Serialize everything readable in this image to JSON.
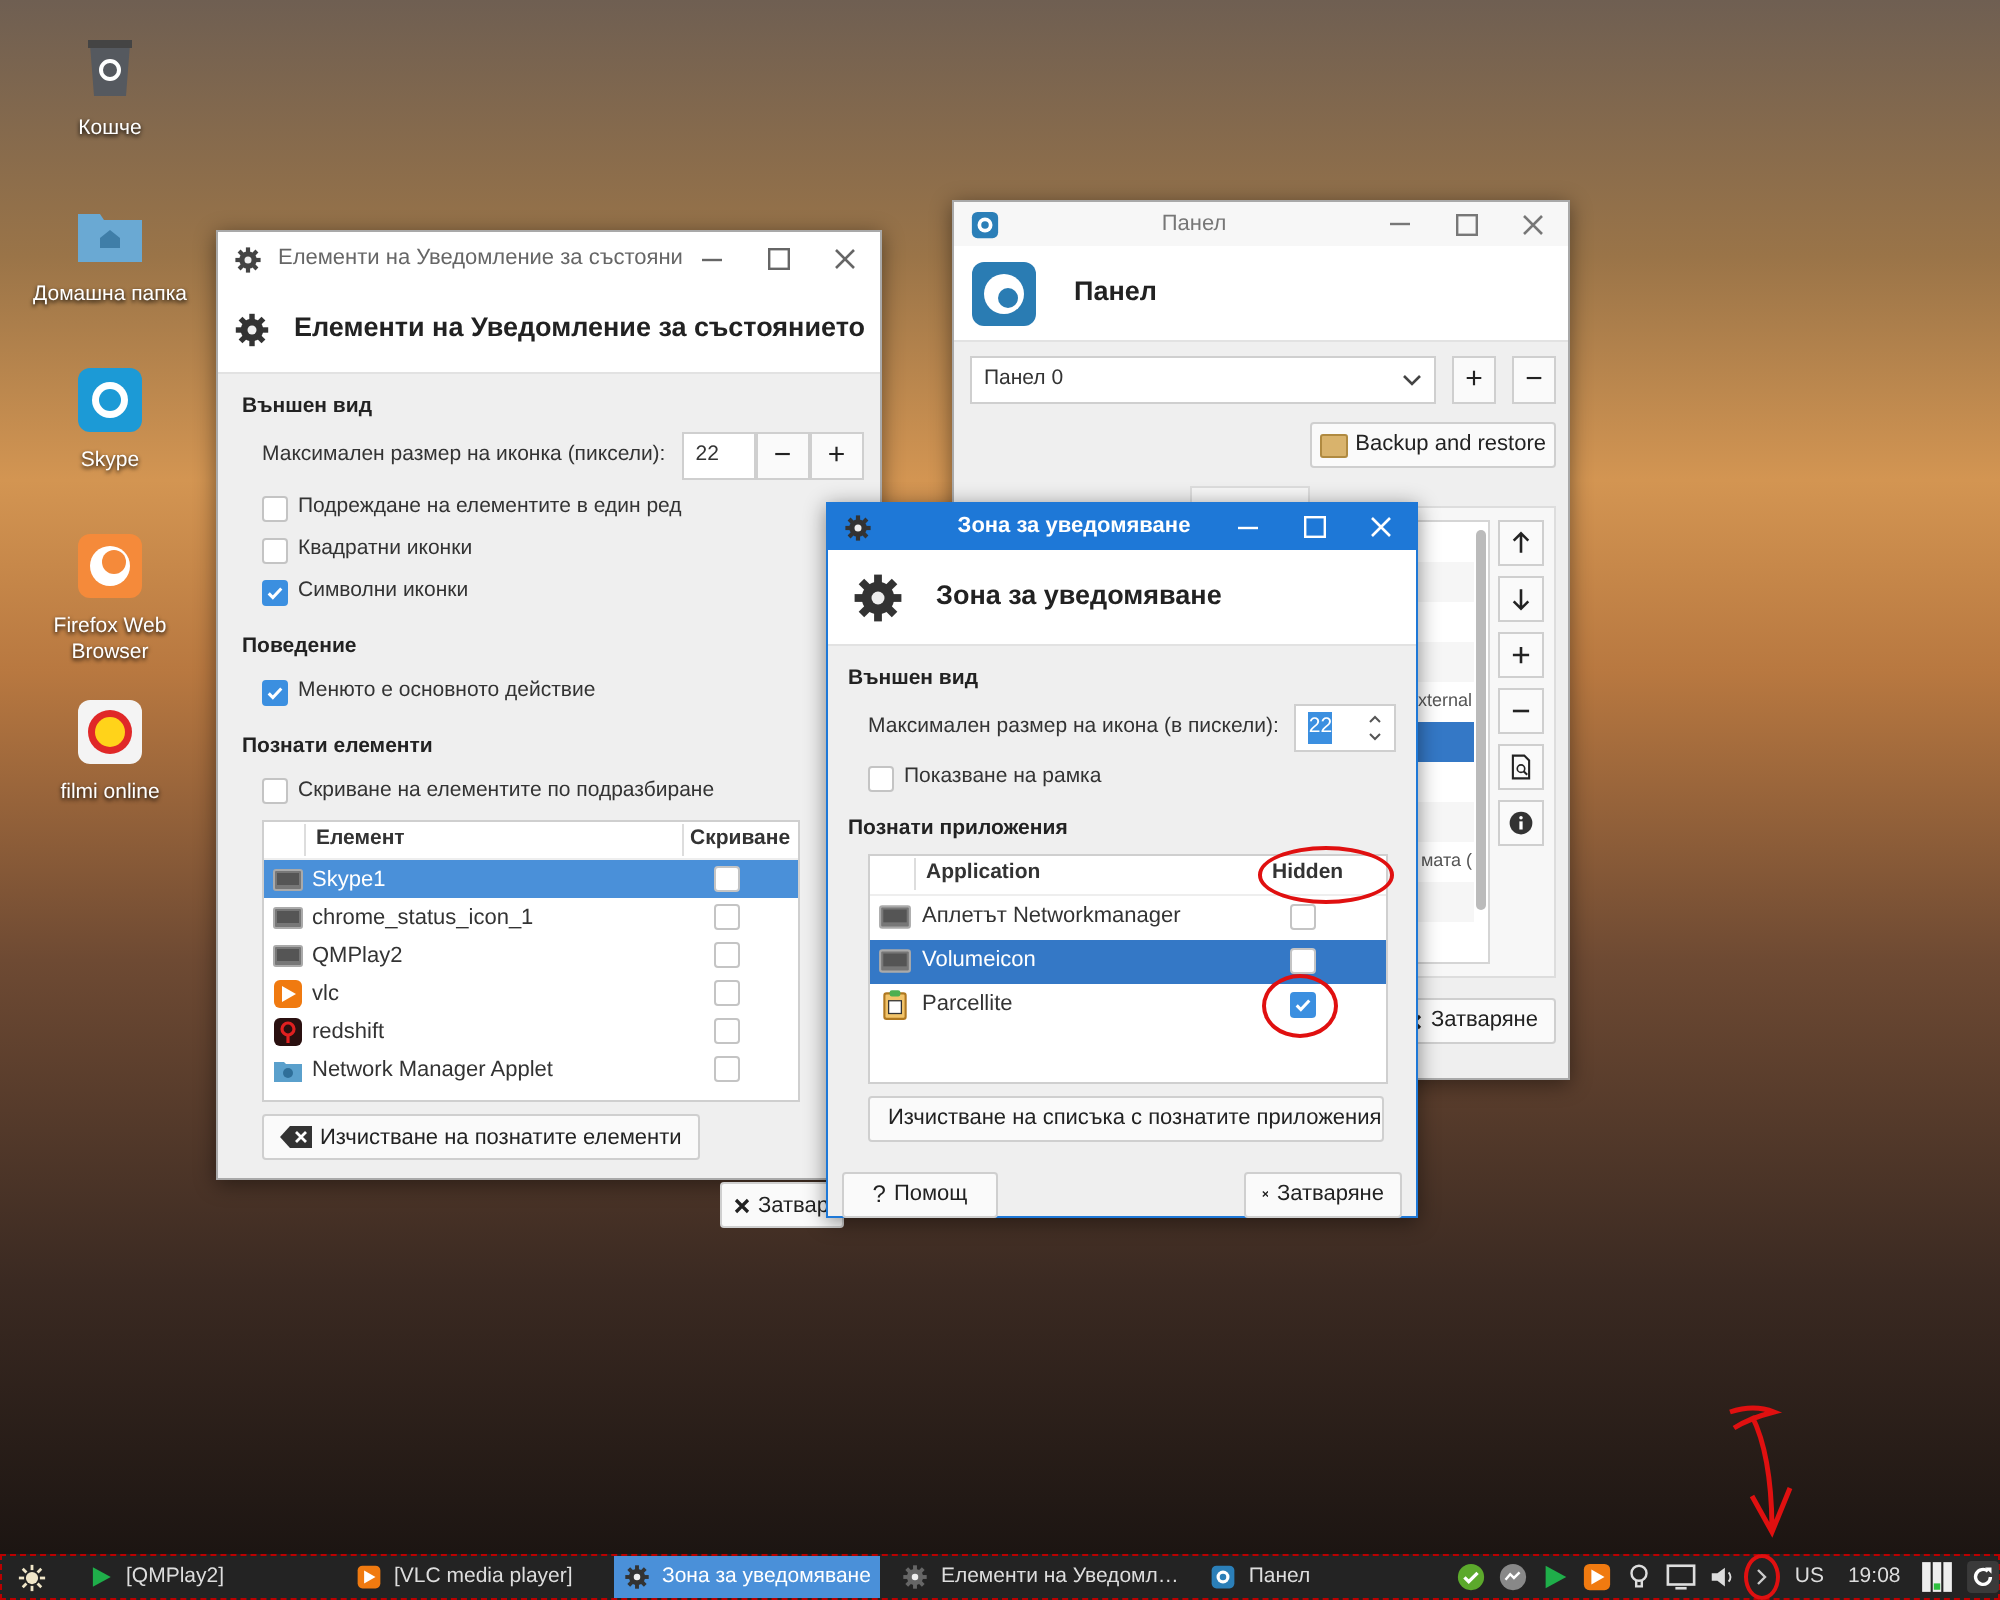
{
  "desktop_icons": [
    {
      "label": "Кошче",
      "kind": "trash"
    },
    {
      "label": "Домашна папка",
      "kind": "folder"
    },
    {
      "label": "Skype",
      "kind": "skype"
    },
    {
      "label": "Firefox Web Browser",
      "kind": "firefox"
    },
    {
      "label": "filmi online",
      "kind": "sun"
    }
  ],
  "status_items_window": {
    "title": "Елементи на Уведомление за състояни",
    "heading": "Елементи на Уведомление за състоянието",
    "appearance_heading": "Външен вид",
    "size_label": "Максимален размер на иконка (пиксели):",
    "size_value": "22",
    "size_minus": "−",
    "size_plus": "+",
    "appearance_options": [
      {
        "label": "Подреждане на елементите в един ред",
        "checked": false
      },
      {
        "label": "Квадратни иконки",
        "checked": false
      },
      {
        "label": "Символни иконки",
        "checked": true
      }
    ],
    "behavior_heading": "Поведение",
    "behavior_options": [
      {
        "label": "Менюто е основното действие",
        "checked": true
      }
    ],
    "known_heading": "Познати елементи",
    "hide_default": {
      "label": "Скриване на елементите по подразбиране",
      "checked": false
    },
    "columns": [
      "Елемент",
      "Скриване"
    ],
    "rows": [
      {
        "name": "Skype1",
        "kind": "generic",
        "hidden": false,
        "selected": true
      },
      {
        "name": "chrome_status_icon_1",
        "kind": "generic",
        "hidden": false,
        "selected": false
      },
      {
        "name": "QMPlay2",
        "kind": "generic",
        "hidden": false,
        "selected": false
      },
      {
        "name": "vlc",
        "kind": "vlc",
        "hidden": false,
        "selected": false
      },
      {
        "name": "redshift",
        "kind": "redshift",
        "hidden": false,
        "selected": false
      },
      {
        "name": "Network Manager Applet",
        "kind": "network",
        "hidden": false,
        "selected": false
      }
    ],
    "clear_button": "Изчистване на познатите елементи",
    "close_button": "Затвар"
  },
  "panel_window": {
    "title": "Панел",
    "heading": "Панел",
    "panel_select": "Панел 0",
    "add_button": "+",
    "remove_button": "−",
    "backup_button": "Backup and restore",
    "list_rows": [
      {
        "selected": false
      },
      {
        "selected": false
      },
      {
        "selected": false
      },
      {
        "selected": false
      },
      {
        "text": "xternal",
        "selected": false
      },
      {
        "selected": true
      },
      {
        "selected": false
      },
      {
        "selected": false
      },
      {
        "text": "мата (",
        "selected": false
      },
      {
        "selected": false
      },
      {
        "selected": false
      }
    ],
    "side_buttons": [
      {
        "kind": "up"
      },
      {
        "kind": "down"
      },
      {
        "kind": "add"
      },
      {
        "kind": "remove"
      },
      {
        "kind": "document"
      },
      {
        "kind": "info"
      }
    ],
    "close_button": "Затваряне"
  },
  "notification_dialog": {
    "title": "Зона за уведомяване",
    "heading": "Зона за уведомяване",
    "appearance_heading": "Външен вид",
    "size_label": "Максимален размер на икона (в пискели):",
    "size_value": "22",
    "size_value_selected": true,
    "frame_option": {
      "label": "Показване на рамка",
      "checked": false
    },
    "known_heading": "Познати приложения",
    "columns": [
      {
        "label": "Application",
        "circled": false
      },
      {
        "label": "Hidden",
        "circled": true
      }
    ],
    "rows": [
      {
        "name": "Аплетът Networkmanager",
        "kind": "generic",
        "hidden": false,
        "selected": false,
        "circled": false
      },
      {
        "name": "Volumeicon",
        "kind": "generic",
        "hidden": false,
        "selected": true,
        "circled": false
      },
      {
        "name": "Parcellite",
        "kind": "clipboard",
        "hidden": true,
        "selected": false,
        "circled": true
      }
    ],
    "clear_button": "Изчистване на списъка с познатите приложения",
    "help_button": {
      "icon": "?",
      "label": "Помощ"
    },
    "close_button": "Затваряне"
  },
  "taskbar": {
    "tasks": [
      {
        "label": "[QMPlay2]",
        "kind": "play",
        "selected": false
      },
      {
        "label": "[VLC media player]",
        "kind": "vlc",
        "selected": false
      },
      {
        "label": "Зона за уведомяване",
        "kind": "gear",
        "selected": true
      },
      {
        "label": "Елементи на Уведомл…",
        "kind": "gear",
        "selected": false
      },
      {
        "label": "Панел",
        "kind": "panel",
        "selected": false
      }
    ],
    "tray_icons": [
      {
        "kind": "check"
      },
      {
        "kind": "chat"
      },
      {
        "kind": "play"
      },
      {
        "kind": "vlc"
      },
      {
        "kind": "bulb"
      },
      {
        "kind": "monitor"
      },
      {
        "kind": "volume"
      }
    ],
    "chevron": {
      "circled": true,
      "arrow": true
    },
    "keyboard_layout": "US",
    "clock": "19:08",
    "trailing_icons": [
      {
        "kind": "bars"
      },
      {
        "kind": "refresh"
      }
    ]
  }
}
